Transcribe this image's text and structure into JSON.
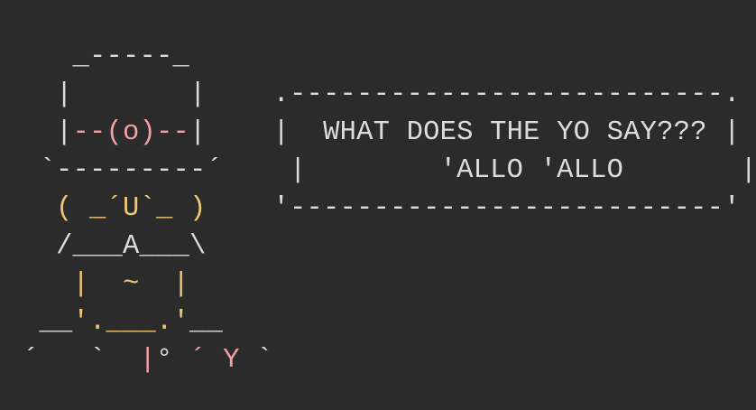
{
  "colors": {
    "background": "#2b2b2b",
    "text": "#dcdcdc",
    "pink": "#f2a0a0",
    "yellow": "#f0c674"
  },
  "lines": [
    [
      {
        "t": "   _-----_",
        "c": "gray"
      }
    ],
    [
      {
        "t": "  |       |    ",
        "c": "gray"
      },
      {
        "t": ".--------------------------.",
        "c": "gray"
      }
    ],
    [
      {
        "t": "  |",
        "c": "gray"
      },
      {
        "t": "--(o)--",
        "c": "pink"
      },
      {
        "t": "|    |  WHAT DOES THE YO SAY??? |",
        "c": "gray"
      }
    ],
    [
      {
        "t": " `---------´    |        'ALLO 'ALLO       |",
        "c": "gray"
      }
    ],
    [
      {
        "t": "  ( _´U`_ )    ",
        "c": "yellow"
      },
      {
        "t": "'--------------------------'",
        "c": "gray"
      }
    ],
    [
      {
        "t": "  /___A___\\",
        "c": "gray"
      }
    ],
    [
      {
        "t": "   |  ~  |",
        "c": "yellow"
      }
    ],
    [
      {
        "t": " __",
        "c": "gray"
      },
      {
        "t": "'.___.'",
        "c": "yellow"
      },
      {
        "t": "__",
        "c": "gray"
      }
    ],
    [
      {
        "t": "´   `  ",
        "c": "gray"
      },
      {
        "t": "|",
        "c": "pink"
      },
      {
        "t": "° ",
        "c": "gray"
      },
      {
        "t": "´ Y",
        "c": "pink"
      },
      {
        "t": " `",
        "c": "gray"
      }
    ]
  ]
}
